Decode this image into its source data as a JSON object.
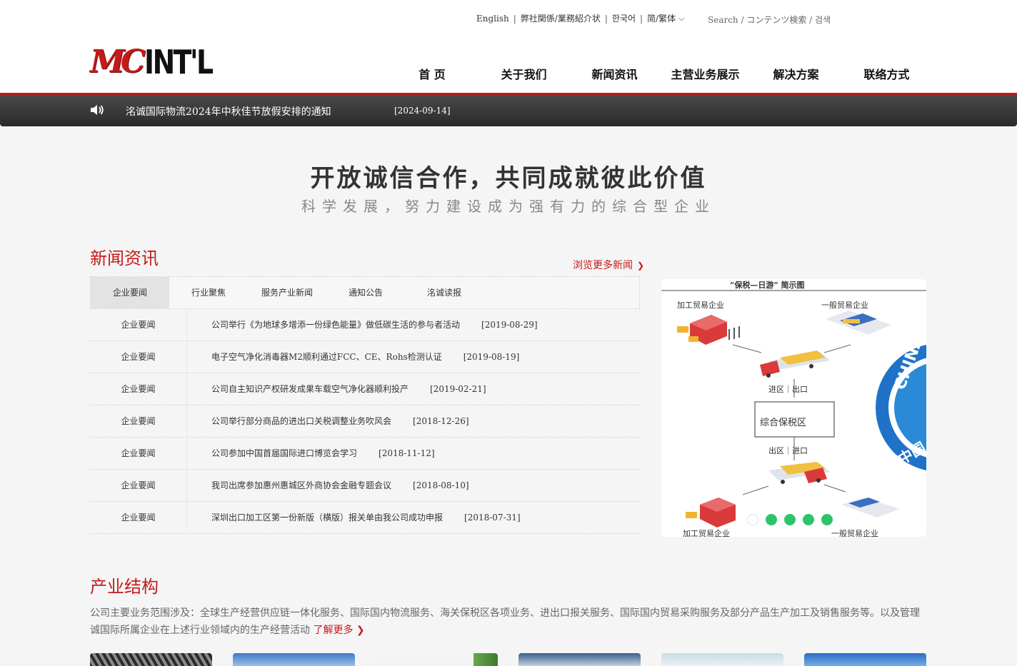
{
  "topbar": {
    "links": [
      "English",
      "弊社関係/業務紹介状",
      "한국어",
      "简/繁体"
    ],
    "search_label": "Search / コンテンツ検索 / 검색"
  },
  "logo": {
    "mark": "MC",
    "text": "INT'L"
  },
  "nav": [
    "首 页",
    "关于我们",
    "新闻资讯",
    "主营业务展示",
    "解决方案",
    "联络方式"
  ],
  "notice": {
    "title": "洺诚国际物流2024年中秋佳节放假安排的通知",
    "date": "[2024-09-14]"
  },
  "slogan": {
    "main": "开放诚信合作，共同成就彼此价值",
    "sub": "科学发展，努力建设成为强有力的综合型企业"
  },
  "news": {
    "title": "新闻资讯",
    "more": "浏览更多新闻",
    "tabs": [
      "企业要闻",
      "行业聚焦",
      "服务产业新闻",
      "通知公告",
      "洺诚读报"
    ],
    "items": [
      {
        "cat": "企业要闻",
        "title": "公司举行《为地球多增添一份绿色能量》做低碳生活的参与者活动",
        "date": "[2019-08-29]"
      },
      {
        "cat": "企业要闻",
        "title": "电子空气净化消毒器M2顺利通过FCC、CE、Rohs检测认证",
        "date": "[2019-08-19]"
      },
      {
        "cat": "企业要闻",
        "title": "公司自主知识产权研发成果车载空气净化器顺利投产",
        "date": "[2019-02-21]"
      },
      {
        "cat": "企业要闻",
        "title": "公司举行部分商品的进出口关税调整业务吹风会",
        "date": "[2018-12-26]"
      },
      {
        "cat": "企业要闻",
        "title": "公司参加中国首届国际进口博览会学习",
        "date": "[2018-11-12]"
      },
      {
        "cat": "企业要闻",
        "title": "我司出席参加惠州惠城区外商协会金融专题会议",
        "date": "[2018-08-10]"
      },
      {
        "cat": "企业要闻",
        "title": "深圳出口加工区第一份新版（横版）报关单由我公司成功申报",
        "date": "[2018-07-31]"
      }
    ]
  },
  "diagram": {
    "title": "“保税—日游” 简示图",
    "top_left": "加工贸易企业",
    "top_right": "一般贸易企业",
    "in_out_1": "进区｜出口",
    "center": "综合保税区",
    "in_out_2": "出区｜进口",
    "bottom_left": "加工贸易企业",
    "bottom_right": "一般贸易企业",
    "seal_text": "CHINA INT",
    "seal_cn": "中国",
    "dots": 5
  },
  "industry": {
    "title": "产业结构",
    "desc": "公司主要业务范围涉及：全球生产经营供应链一体化服务、国际国内物流服务、海关保税区各项业务、进出口报关服务、国际国内贸易采购服务及部分产品生产加工及销售服务等。以及管理诚国际所属企业在上述行业领域内的生产经营活动",
    "more": "了解更多"
  },
  "colors": {
    "brand": "#c41a1a",
    "dot": "#2cc46a",
    "notice_bg": "#333333"
  }
}
